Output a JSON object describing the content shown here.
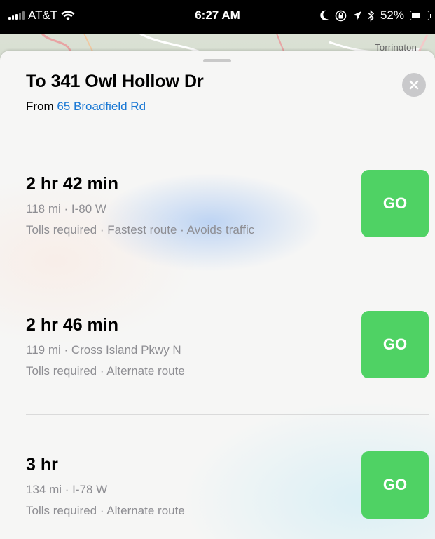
{
  "status_bar": {
    "carrier": "AT&T",
    "time": "6:27 AM",
    "battery_percent": "52%",
    "battery_level": 0.52,
    "icons": [
      "signal-icon",
      "wifi-icon",
      "moon-icon",
      "orientation-lock-icon",
      "location-icon",
      "bluetooth-icon",
      "battery-icon"
    ]
  },
  "map": {
    "place_label": "Torrington"
  },
  "directions": {
    "title": "To 341 Owl Hollow Dr",
    "from_prefix": "From",
    "from_address": "65 Broadfield Rd"
  },
  "routes": [
    {
      "duration": "2 hr 42 min",
      "distance_road": "118 mi · I-80 W",
      "details": "Tolls required · Fastest route · Avoids traffic",
      "go_label": "GO"
    },
    {
      "duration": "2 hr 46 min",
      "distance_road": "119 mi · Cross Island Pkwy N",
      "details": "Tolls required · Alternate route",
      "go_label": "GO"
    },
    {
      "duration": "3 hr",
      "distance_road": "134 mi · I-78 W",
      "details": "Tolls required · Alternate route",
      "go_label": "GO"
    }
  ],
  "colors": {
    "go_green": "#4fd264",
    "link_blue": "#1a78d4",
    "secondary_text": "#8e8e93"
  }
}
